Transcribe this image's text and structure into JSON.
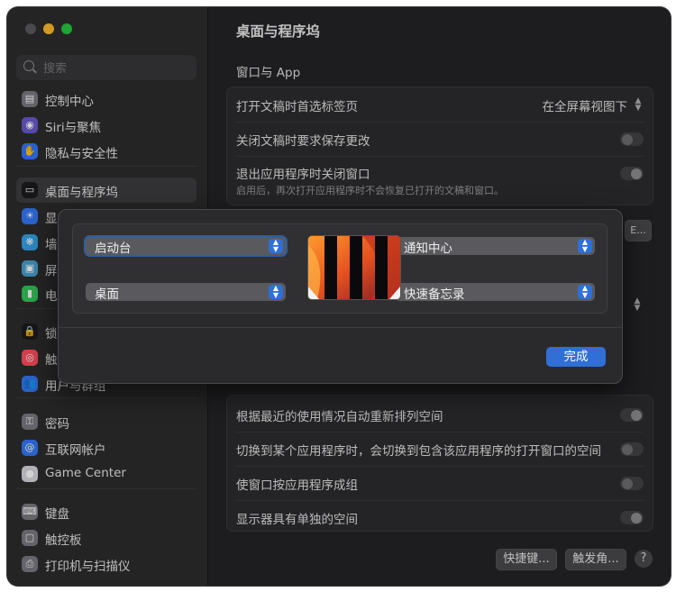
{
  "sidebar": {
    "search_placeholder": "搜索",
    "items": [
      {
        "label": "控制中心",
        "icon": "control-center-icon",
        "color": "#7b7b80",
        "glyph": "▤"
      },
      {
        "label": "Siri与聚焦",
        "icon": "siri-icon",
        "color": "#6a5acd",
        "glyph": "◉"
      },
      {
        "label": "隐私与安全性",
        "icon": "hand-icon",
        "color": "#3478f6",
        "glyph": "✋"
      },
      {
        "label": "桌面与程序坞",
        "icon": "dock-icon",
        "color": "#1c1c1e",
        "glyph": "▭",
        "selected": true
      },
      {
        "label": "显",
        "icon": "display-icon",
        "color": "#3478f6",
        "glyph": "☀"
      },
      {
        "label": "墙",
        "icon": "wallpaper-icon",
        "color": "#35a3e8",
        "glyph": "❋"
      },
      {
        "label": "屏",
        "icon": "screensaver-icon",
        "color": "#4aa0d0",
        "glyph": "▣"
      },
      {
        "label": "电",
        "icon": "battery-icon",
        "color": "#34c759",
        "glyph": "▮"
      },
      {
        "label": "锁",
        "icon": "lock-icon",
        "color": "#1c1c1e",
        "glyph": "🔒"
      },
      {
        "label": "触",
        "icon": "touchid-icon",
        "color": "#ff4f5e",
        "glyph": "◎"
      },
      {
        "label": "用户与群组",
        "icon": "users-icon",
        "color": "#3478f6",
        "glyph": "👥"
      },
      {
        "label": "密码",
        "icon": "key-icon",
        "color": "#7b7b80",
        "glyph": "⚿"
      },
      {
        "label": "互联网帐户",
        "icon": "at-icon",
        "color": "#3478f6",
        "glyph": "@"
      },
      {
        "label": "Game Center",
        "icon": "game-center-icon",
        "color": "#d9d9de",
        "glyph": "●"
      },
      {
        "label": "键盘",
        "icon": "keyboard-icon",
        "color": "#7b7b80",
        "glyph": "⌨"
      },
      {
        "label": "触控板",
        "icon": "trackpad-icon",
        "color": "#7b7b80",
        "glyph": "▢"
      },
      {
        "label": "打印机与扫描仪",
        "icon": "printer-icon",
        "color": "#7b7b80",
        "glyph": "⎙"
      }
    ]
  },
  "main": {
    "title": "桌面与程序坞",
    "section_heading": "窗口与 App",
    "rows_top": {
      "tab_pref_label": "打开文稿时首选标签页",
      "tab_pref_value": "在全屏幕视图下",
      "ask_save_label": "关闭文稿时要求保存更改",
      "close_windows_label": "退出应用程序时关闭窗口",
      "close_windows_sub": "启用后，再次打开应用程序时不会恢复已打开的文稿和窗口。"
    },
    "rows_bottom": [
      {
        "label": "根据最近的使用情况自动重新排列空间",
        "on": true
      },
      {
        "label": "切换到某个应用程序时，会切换到包含该应用程序的打开窗口的空间",
        "on": false
      },
      {
        "label": "使窗口按应用程序成组",
        "on": false
      },
      {
        "label": "显示器具有单独的空间",
        "on": true
      }
    ],
    "hidden_button_fragment": "E...",
    "shortcuts_button": "快捷键...",
    "hot_corners_button": "触发角...",
    "help_label": "?"
  },
  "sheet": {
    "top_left": "启动台",
    "top_right": "通知中心",
    "bottom_left": "桌面",
    "bottom_right": "快速备忘录",
    "done_label": "完成"
  },
  "colors": {
    "accent": "#2f6fd6",
    "window_bg": "#242426",
    "sidebar_bg": "#2c2c2e"
  }
}
